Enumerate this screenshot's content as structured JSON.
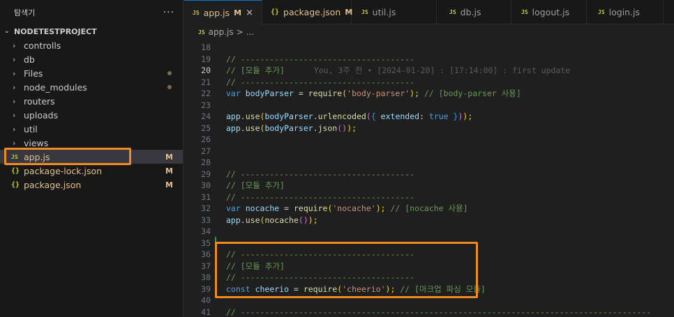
{
  "sidebar": {
    "title": "탐색기",
    "more": "···",
    "project": "NODETESTPROJECT",
    "items": [
      {
        "label": "controlls",
        "type": "folder"
      },
      {
        "label": "db",
        "type": "folder"
      },
      {
        "label": "Files",
        "type": "folder",
        "dot": true
      },
      {
        "label": "node_modules",
        "type": "folder",
        "dot": true
      },
      {
        "label": "routers",
        "type": "folder"
      },
      {
        "label": "uploads",
        "type": "folder"
      },
      {
        "label": "util",
        "type": "folder"
      },
      {
        "label": "views",
        "type": "folder"
      },
      {
        "label": "app.js",
        "type": "js",
        "badge": "M"
      },
      {
        "label": "package-lock.json",
        "type": "json",
        "badge": "M"
      },
      {
        "label": "package.json",
        "type": "json",
        "badge": "M"
      }
    ]
  },
  "icons": {
    "js": "JS",
    "json": "{}"
  },
  "tabs": [
    {
      "label": "app.js",
      "icon": "JS",
      "badge": "M",
      "close": "×"
    },
    {
      "label": "package.json",
      "icon": "{}",
      "badge": "M"
    },
    {
      "label": "util.js",
      "icon": "JS"
    },
    {
      "label": "db.js",
      "icon": "JS"
    },
    {
      "label": "logout.js",
      "icon": "JS"
    },
    {
      "label": "login.js",
      "icon": "JS"
    }
  ],
  "breadcrumb": {
    "file": "app.js",
    "sep": ">",
    "rest": "..."
  },
  "code": {
    "dash_short": "// ------------------------------------",
    "dash_long": "// -------------------------------------------------------------------------------------",
    "module_comment": "// [모듈 추가]",
    "blame": "You, 3주 전 • [2024-01-20] : [17:14:00] : first update",
    "line_numbers": [
      "18",
      "19",
      "20",
      "21",
      "22",
      "23",
      "24",
      "25",
      "26",
      "27",
      "28",
      "29",
      "30",
      "31",
      "32",
      "33",
      "34",
      "35",
      "36",
      "37",
      "38",
      "39",
      "40",
      "41"
    ],
    "bodyparser": {
      "kw": "var",
      "name": "bodyParser",
      "eq": " = ",
      "fn": "require",
      "open": "(",
      "str": "'body-parser'",
      "close": ");",
      "comment": " // [body-parser 사용]"
    },
    "use1": {
      "obj": "app",
      "dot": ".",
      "fn": "use",
      "o1": "(",
      "var": "bodyParser",
      "dot2": ".",
      "fn2": "urlencoded",
      "o2": "(",
      "o3": "{ ",
      "key": "extended",
      "colon": ": ",
      "val": "true",
      "c3": " }",
      "c2": ")",
      "c1": ");"
    },
    "use2": {
      "obj": "app",
      "dot": ".",
      "fn": "use",
      "o1": "(",
      "var": "bodyParser",
      "dot2": ".",
      "fn2": "json",
      "o2": "()",
      "c1": ");"
    },
    "nocache": {
      "kw": "var",
      "name": "nocache",
      "eq": " = ",
      "fn": "require",
      "open": "(",
      "str": "'nocache'",
      "close": ");",
      "comment": " // [nocache 사용]"
    },
    "use3": {
      "obj": "app",
      "dot": ".",
      "fn": "use",
      "o1": "(",
      "fn2": "nocache",
      "o2": "()",
      "c1": ");"
    },
    "cheerio": {
      "kw": "const",
      "name": "cheerio",
      "eq": " = ",
      "fn": "require",
      "open": "(",
      "str": "'cheerio'",
      "close": ");",
      "comment": " // [마크업 파싱 모듈]"
    }
  },
  "colors": {
    "accent": "#f08a24",
    "modified": "#e2c08d",
    "js_icon": "#cbcb41"
  }
}
